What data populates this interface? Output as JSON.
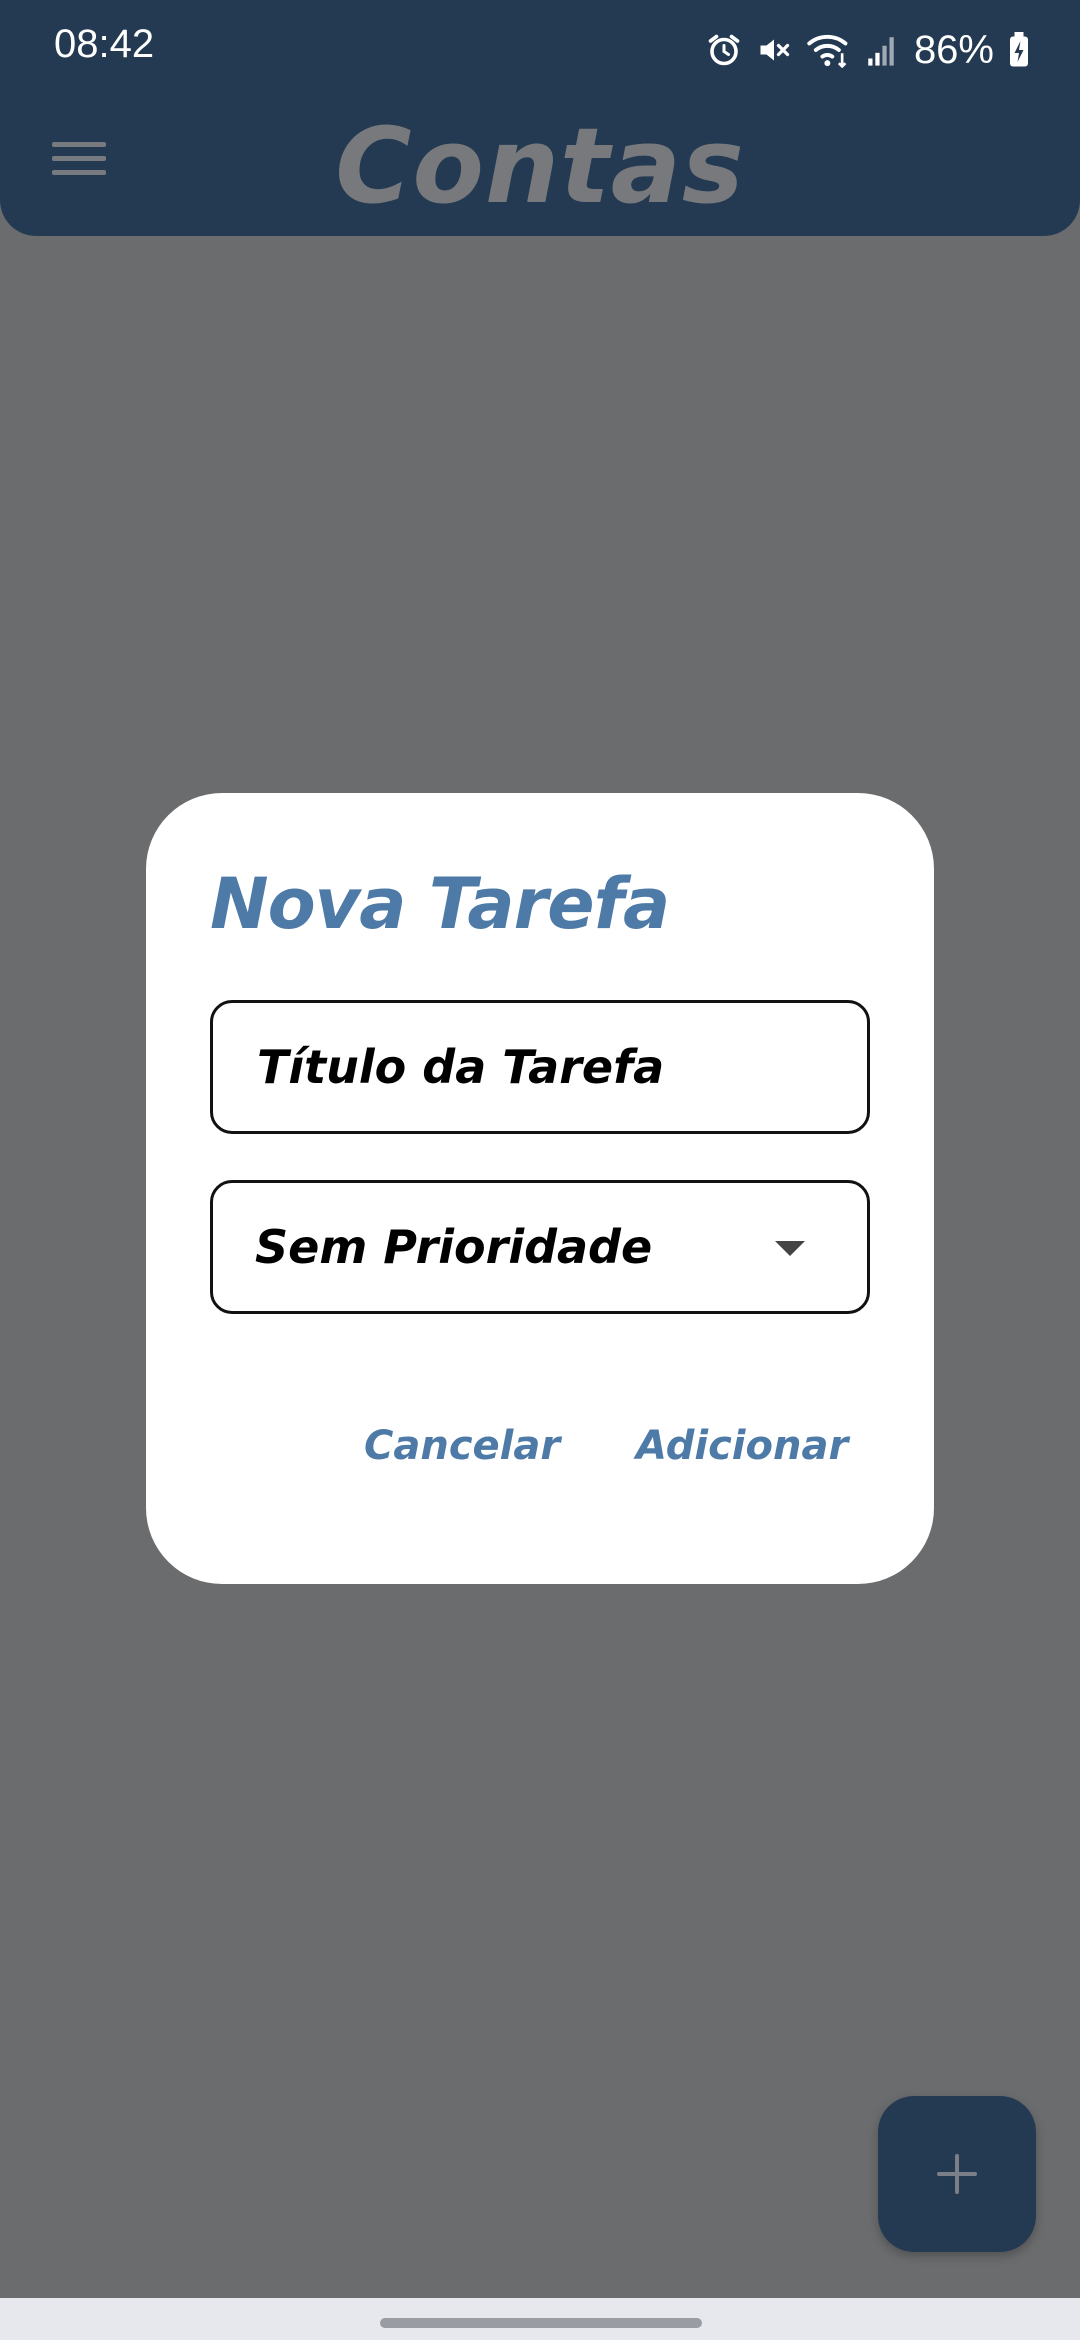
{
  "status_bar": {
    "time": "08:42",
    "battery": "86%",
    "icons": [
      "alarm-icon",
      "mute-icon",
      "wifi-icon",
      "signal-icon",
      "battery-charging-icon"
    ]
  },
  "app_bar": {
    "title": "Contas",
    "menu_icon": "hamburger-menu-icon"
  },
  "dialog": {
    "title": "Nova Tarefa",
    "title_field_placeholder": "Título da Tarefa",
    "priority_select": {
      "selected": "Sem Prioridade"
    },
    "cancel_label": "Cancelar",
    "add_label": "Adicionar"
  },
  "fab": {
    "icon": "plus-icon"
  },
  "colors": {
    "header_bg": "#243a52",
    "scrim_bg": "#6b6c6e",
    "accent": "#4d7aa6",
    "dialog_bg": "#ffffff"
  }
}
